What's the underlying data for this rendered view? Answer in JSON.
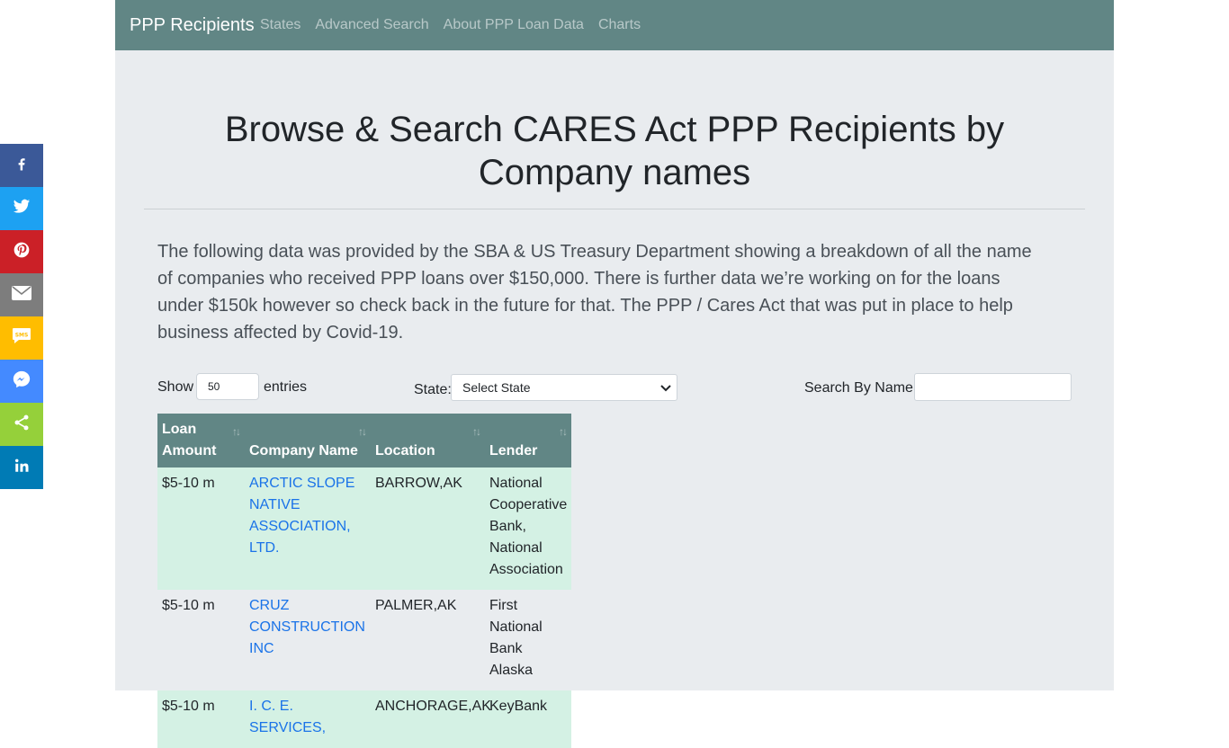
{
  "nav": {
    "brand": "PPP Recipients",
    "links": [
      "States",
      "Advanced Search",
      "About PPP Loan Data",
      "Charts"
    ]
  },
  "page": {
    "title": "Browse & Search CARES Act PPP Recipients by Company names",
    "intro": "The following data was provided by the SBA & US Treasury Department showing a breakdown of all the name of companies who received PPP loans over $150,000. There is further data we’re working on for the loans under $150k however so check back in the future for that. The PPP / Cares Act that was put in place to help business affected by Covid-19."
  },
  "controls": {
    "show_label": "Show",
    "entries_value": "50",
    "entries_label": "entries",
    "state_label": "State:",
    "state_value": "Select State",
    "search_label": "Search By Name",
    "search_value": ""
  },
  "table": {
    "headers": [
      "Loan Amount",
      "Company Name",
      "Location",
      "Lender"
    ],
    "rows": [
      {
        "amount": "$5-10 m",
        "company": "ARCTIC SLOPE NATIVE ASSOCIATION, LTD.",
        "location": "BARROW,AK",
        "lender": "National Cooperative Bank, National Association"
      },
      {
        "amount": "$5-10 m",
        "company": "CRUZ CONSTRUCTION INC",
        "location": "PALMER,AK",
        "lender": "First National Bank Alaska"
      },
      {
        "amount": "$5-10 m",
        "company": "I. C. E. SERVICES,",
        "location": "ANCHORAGE,AK",
        "lender": "KeyBank"
      }
    ]
  },
  "social": [
    {
      "name": "facebook-icon",
      "color": "#3b5998"
    },
    {
      "name": "twitter-icon",
      "color": "#1da1f2"
    },
    {
      "name": "pinterest-icon",
      "color": "#cb2027"
    },
    {
      "name": "email-icon",
      "color": "#7d7d7d"
    },
    {
      "name": "sms-icon",
      "color": "#ffbd00"
    },
    {
      "name": "messenger-icon",
      "color": "#448aff"
    },
    {
      "name": "share-icon",
      "color": "#95d03a"
    },
    {
      "name": "linkedin-icon",
      "color": "#007bb5"
    }
  ]
}
